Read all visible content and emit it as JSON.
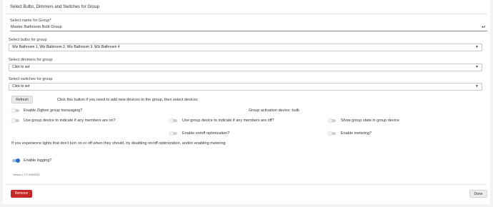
{
  "dialog": {
    "title": "Select Bulbs, Dimmers and Switches for Group"
  },
  "group_name": {
    "label": "Select name for Group*",
    "value": "Master Bathroom Bulb Group",
    "enter_icon": "↵"
  },
  "bulbs": {
    "label": "Select bulbs for group",
    "value": "Wiz Bathroom 1, Wiz Bathroom 2, Wiz Bathroom 3, Wiz Bathroom 4"
  },
  "dimmers": {
    "label": "Select dimmers for group",
    "value": "Click to set"
  },
  "switches": {
    "label": "Select switches for group",
    "value": "Click to set"
  },
  "refresh": {
    "button_label": "Refresh",
    "note": "Click this button if you need to add new devices to the group, then select devices"
  },
  "options": {
    "zigbee_messaging": {
      "label": "Enable Zigbee group messaging?",
      "on": false
    },
    "activation_device": "Group activation device: bulb",
    "any_on": {
      "label": "Use group device to indicate if any members are on?",
      "on": false
    },
    "any_off": {
      "label": "Use group device to indicate if any members are off?",
      "on": false
    },
    "show_state": {
      "label": "Show group state in group device",
      "on": false
    },
    "onoff_optimization": {
      "label": "Enable on/off optimization?",
      "on": false
    },
    "metering": {
      "label": "Enable metering?",
      "on": false
    },
    "hint": "If you experience lights that don't turn on or off when they should, try disabling on/off optimization, and/or enabling metering",
    "logging": {
      "label": "Enable logging?",
      "on": true
    }
  },
  "version_text": "Version 1.3 © 9/26/2022",
  "footer": {
    "remove_label": "Remove",
    "done_label": "Done"
  },
  "colors": {
    "remove": "#c62828",
    "toggle_on": "#2a6fca"
  }
}
